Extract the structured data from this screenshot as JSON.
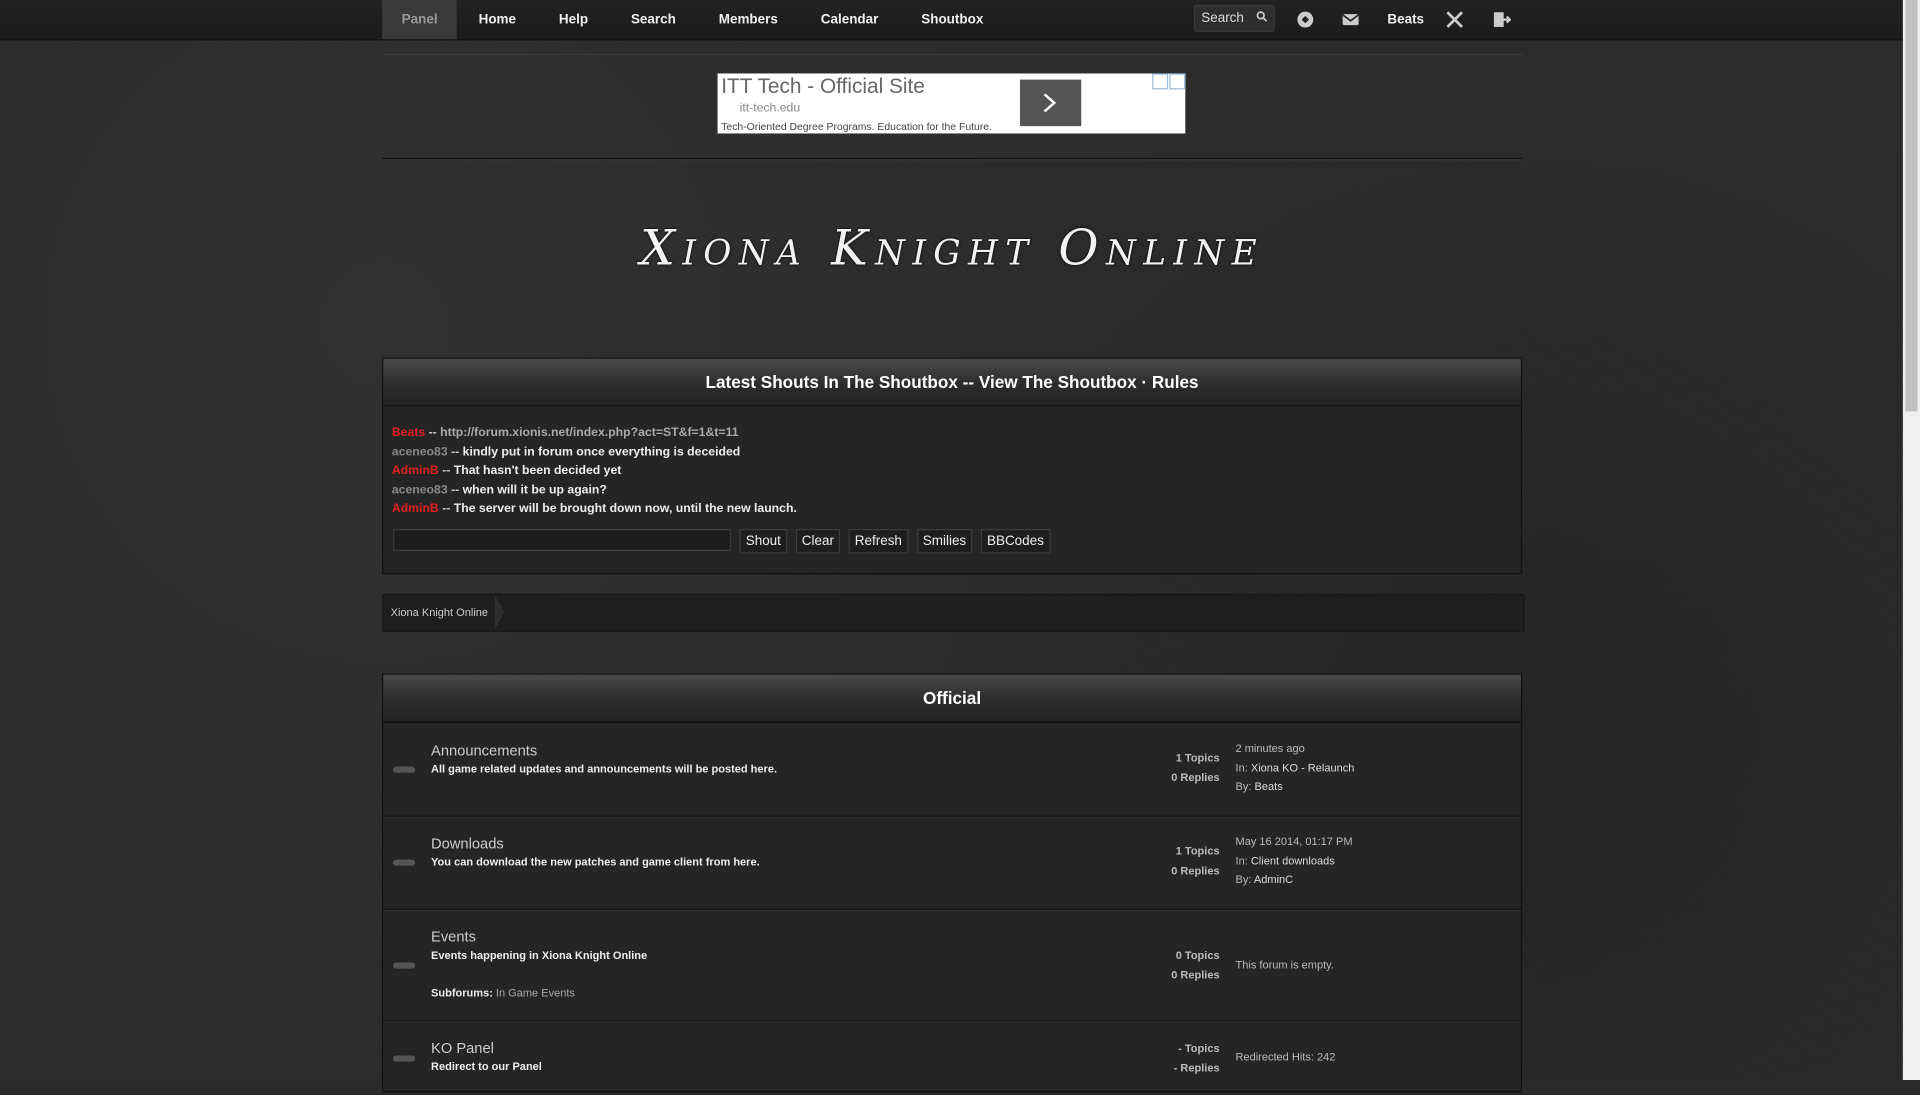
{
  "nav": {
    "items": [
      "Panel",
      "Home",
      "Help",
      "Search",
      "Members",
      "Calendar",
      "Shoutbox"
    ],
    "search_placeholder": "Search",
    "user": "Beats"
  },
  "ad": {
    "title": "ITT Tech - Official Site",
    "url": "itt-tech.edu",
    "desc": "Tech-Oriented Degree Programs. Education for the Future."
  },
  "logo": "Xiona Knight Online",
  "shoutbox": {
    "header": "Latest Shouts In The Shoutbox -- View The Shoutbox · Rules",
    "shouts": [
      {
        "name": "Beats",
        "sep": " -- ",
        "msg": "http://forum.xionis.net/index.php?act=ST&f=1&t=11"
      },
      {
        "name": "aceneo83",
        "sep": " -- ",
        "msg": "kindly put in forum once everything is deceided"
      },
      {
        "name": "AdminB",
        "sep": " -- ",
        "msg": "That hasn't been decided yet"
      },
      {
        "name": "aceneo83",
        "sep": " -- ",
        "msg": "when will it be up again?"
      },
      {
        "name": "AdminB",
        "sep": " -- ",
        "msg": "The server will be brought down now, until the new launch."
      }
    ],
    "buttons": {
      "shout": "Shout",
      "clear": "Clear",
      "refresh": "Refresh",
      "smilies": "Smilies",
      "bbcodes": "BBCodes"
    }
  },
  "breadcrumb": "Xiona Knight Online",
  "category": {
    "title": "Official",
    "forums": [
      {
        "title": "Announcements",
        "desc": "All game related updates and announcements will be posted here.",
        "topics": "1 Topics",
        "replies": "0 Replies",
        "last1": "2 minutes ago",
        "last2_label": "In: ",
        "last2": "Xiona KO - Relaunch",
        "last3_label": "By: ",
        "last3": "Beats"
      },
      {
        "title": "Downloads",
        "desc": "You can download the new patches and game client from here.",
        "topics": "1 Topics",
        "replies": "0 Replies",
        "last1": "May 16 2014, 01:17 PM",
        "last2_label": "In: ",
        "last2": "Client downloads",
        "last3_label": "By: ",
        "last3": "AdminC"
      },
      {
        "title": "Events",
        "desc": "Events happening in Xiona Knight Online",
        "subforums_label": "Subforums: ",
        "subforum": "In Game Events",
        "topics": "0 Topics",
        "replies": "0 Replies",
        "empty": "This forum is empty."
      },
      {
        "title": "KO Panel",
        "desc": "Redirect to our Panel",
        "topics": "- Topics",
        "replies": "- Replies",
        "hits": "Redirected Hits: 242"
      }
    ]
  },
  "colors": {
    "admin_name": "#e02020",
    "member_name": "#888888",
    "background": "#2b2b2b"
  }
}
